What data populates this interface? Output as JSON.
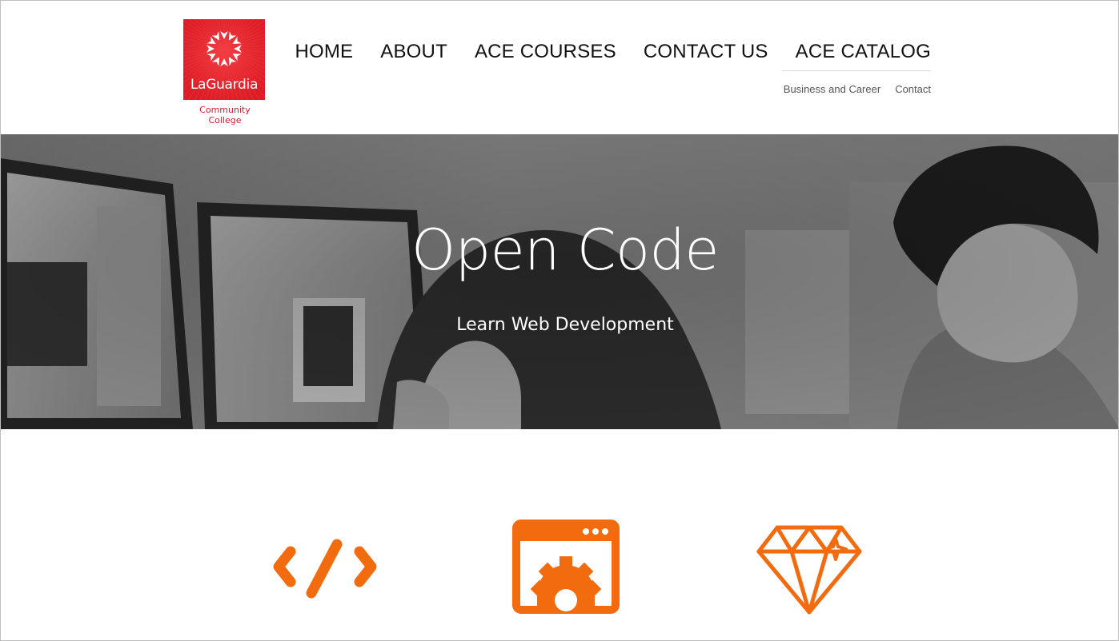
{
  "logo": {
    "name": "LaGuardia",
    "subtitle": "Community College",
    "color": "#e4202a"
  },
  "nav": {
    "main": [
      "HOME",
      "ABOUT",
      "ACE COURSES",
      "CONTACT US",
      "ACE CATALOG"
    ],
    "sub": [
      "Business and Career",
      "Contact"
    ]
  },
  "hero": {
    "title": "Open Code",
    "subtitle": "Learn Web Development"
  },
  "features": {
    "accent": "#f26b0f",
    "icons": [
      "code-icon",
      "browser-gear-icon",
      "diamond-icon"
    ]
  }
}
